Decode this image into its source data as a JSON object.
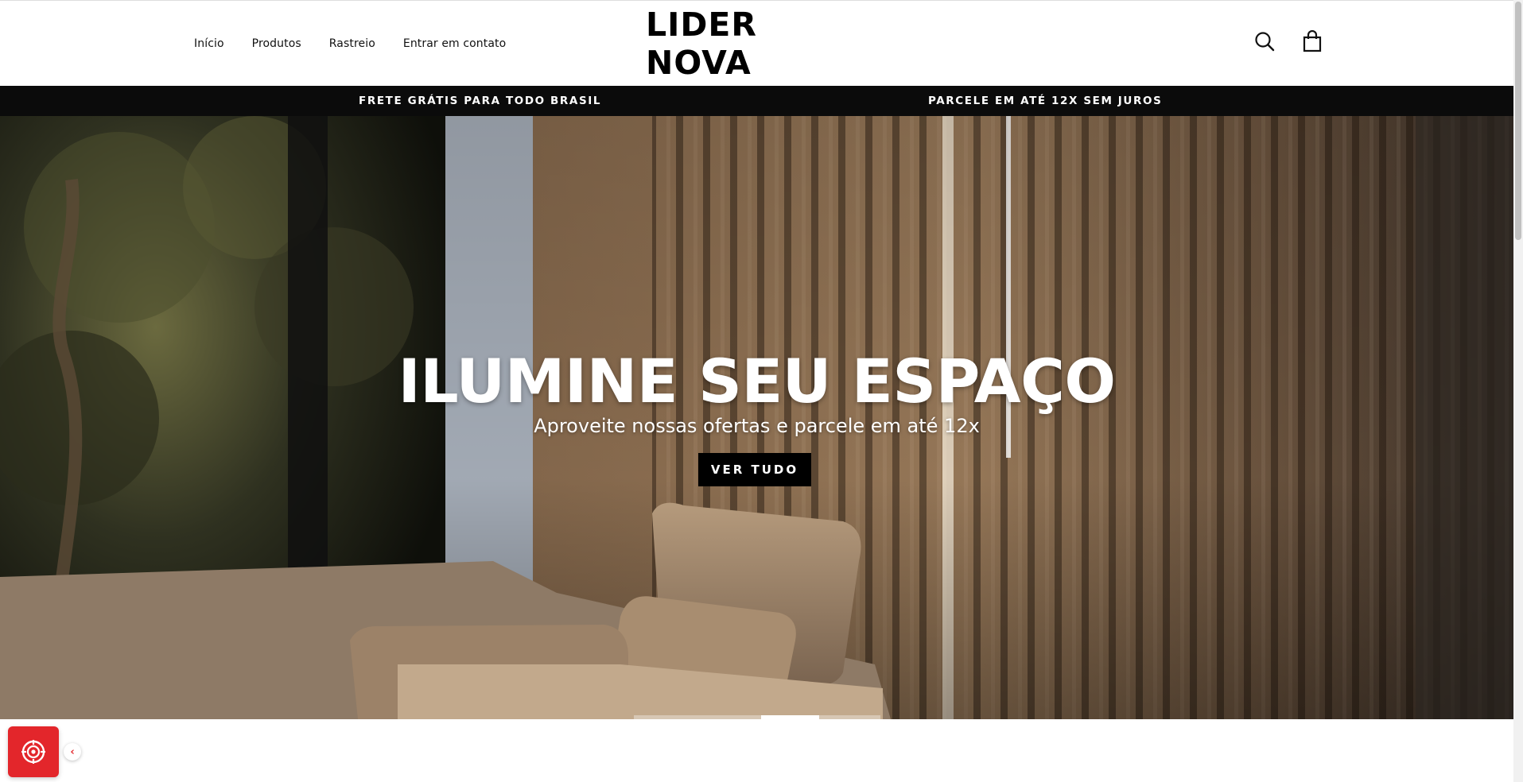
{
  "nav": {
    "items": [
      {
        "label": "Início"
      },
      {
        "label": "Produtos"
      },
      {
        "label": "Rastreio"
      },
      {
        "label": "Entrar em contato"
      }
    ]
  },
  "brand": {
    "logo_text": "LIDER NOVA"
  },
  "header_icons": [
    "search-icon",
    "cart-icon"
  ],
  "announcement": {
    "left": "FRETE GRÁTIS PARA TODO BRASIL",
    "right": "PARCELE EM ATÉ 12X SEM JUROS"
  },
  "hero": {
    "title": "ILUMINE SEU ESPAÇO",
    "subtitle": "Aproveite nossas ofertas e parcele em até 12x",
    "button_label": "VER TUDO",
    "slide_count": 3,
    "active_slide": 2
  },
  "widget": {
    "icon": "accessibility-icon",
    "toggle_icon": "chevron-left-icon"
  },
  "colors": {
    "brand": "#000000",
    "widget": "#e3262b",
    "announce_bg": "#0b0b0b"
  }
}
